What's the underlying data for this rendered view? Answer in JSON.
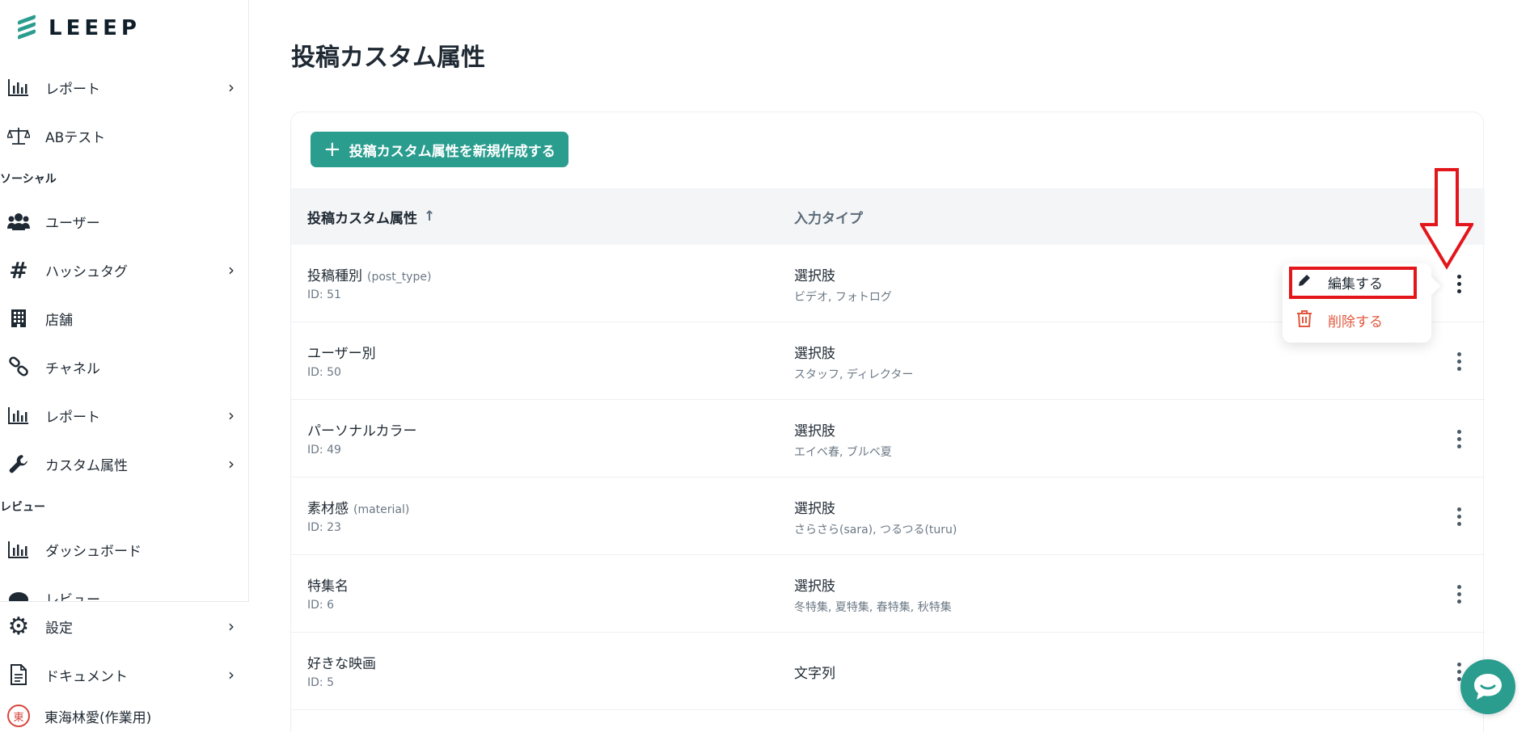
{
  "sidebar": {
    "logo_text": "LEEEP",
    "items_top": [
      {
        "label": "レポート",
        "icon": "bar-chart-icon",
        "has_chevron": true
      },
      {
        "label": "ABテスト",
        "icon": "scale-icon",
        "has_chevron": false
      }
    ],
    "section_social": "ソーシャル",
    "items_social": [
      {
        "label": "ユーザー",
        "icon": "users-icon",
        "has_chevron": false
      },
      {
        "label": "ハッシュタグ",
        "icon": "hashtag-icon",
        "has_chevron": true
      },
      {
        "label": "店舗",
        "icon": "building-icon",
        "has_chevron": false
      },
      {
        "label": "チャネル",
        "icon": "link-icon",
        "has_chevron": false
      },
      {
        "label": "レポート",
        "icon": "bar-chart-icon",
        "has_chevron": true
      },
      {
        "label": "カスタム属性",
        "icon": "wrench-icon",
        "has_chevron": true
      }
    ],
    "section_review": "レビュー",
    "items_review": [
      {
        "label": "ダッシュボード",
        "icon": "bar-chart-icon",
        "has_chevron": false
      },
      {
        "label": "レビュー",
        "icon": "comment-icon",
        "has_chevron": false
      }
    ],
    "bottom": [
      {
        "label": "設定",
        "icon": "gear-icon",
        "has_chevron": true
      },
      {
        "label": "ドキュメント",
        "icon": "document-icon",
        "has_chevron": true
      }
    ],
    "user": {
      "avatar_char": "東",
      "name": "東海林愛(作業用)"
    }
  },
  "page": {
    "title": "投稿カスタム属性",
    "create_button": "投稿カスタム属性を新規作成する"
  },
  "table": {
    "col_name": "投稿カスタム属性",
    "col_type": "入力タイプ",
    "rows": [
      {
        "name": "投稿種別",
        "key": "(post_type)",
        "id": "ID: 51",
        "type": "選択肢",
        "options": "ビデオ, フォトログ"
      },
      {
        "name": "ユーザー別",
        "key": "",
        "id": "ID: 50",
        "type": "選択肢",
        "options": "スタッフ, ディレクター"
      },
      {
        "name": "パーソナルカラー",
        "key": "",
        "id": "ID: 49",
        "type": "選択肢",
        "options": "エイベ春, ブルベ夏"
      },
      {
        "name": "素材感",
        "key": "(material)",
        "id": "ID: 23",
        "type": "選択肢",
        "options": "さらさら(sara), つるつる(turu)"
      },
      {
        "name": "特集名",
        "key": "",
        "id": "ID: 6",
        "type": "選択肢",
        "options": "冬特集, 夏特集, 春特集, 秋特集"
      },
      {
        "name": "好きな映画",
        "key": "",
        "id": "ID: 5",
        "type": "文字列",
        "options": ""
      }
    ]
  },
  "menu": {
    "edit": "編集する",
    "delete": "削除する"
  },
  "colors": {
    "accent": "#2a9d8f",
    "danger": "#e2583e",
    "annotation": "#e3161b"
  }
}
